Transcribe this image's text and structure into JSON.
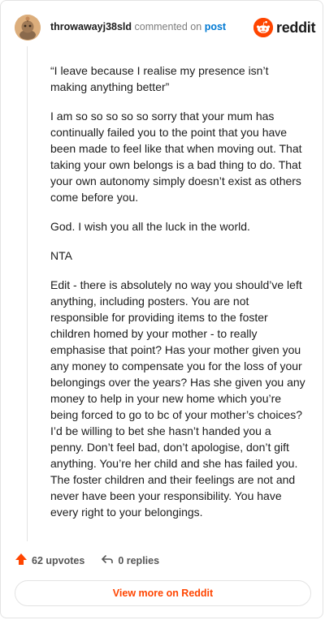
{
  "comment": {
    "username": "throwawayj38sld",
    "commented_on": "commented on",
    "post_link": "post",
    "paragraphs": [
      "“I leave because I realise my presence isn’t making anything better”",
      "I am so so so so so sorry that your mum has continually failed you to the point that you have been made to feel like that when moving out. That taking your own belongs is a bad thing to do. That your own autonomy simply doesn’t exist as others come before you.",
      "God. I wish you all the luck in the world.",
      "NTA",
      "Edit - there is absolutely no way you should’ve left anything, including posters. You are not responsible for providing items to the foster children homed by your mother - to really emphasise that point? Has your mother given you any money to compensate you for the loss of your belongings over the years? Has she given you any money to help in your new home which you’re being forced to go to bc of your mother’s choices? I’d be willing to bet she hasn’t handed you a penny. Don’t feel bad, don’t apologise, don’t gift anything. You’re her child and she has failed you. The foster children and their feelings are not and never have been your responsibility. You have every right to your belongings."
    ]
  },
  "brand": {
    "name": "reddit",
    "color": "#ff4500"
  },
  "footer": {
    "upvotes": "62 upvotes",
    "replies": "0 replies",
    "view_more": "View more on Reddit"
  },
  "icons": {
    "avatar": "avatar-icon",
    "logo": "reddit-logo-icon",
    "upvote": "upvote-arrow-icon",
    "reply": "reply-arrow-icon"
  }
}
